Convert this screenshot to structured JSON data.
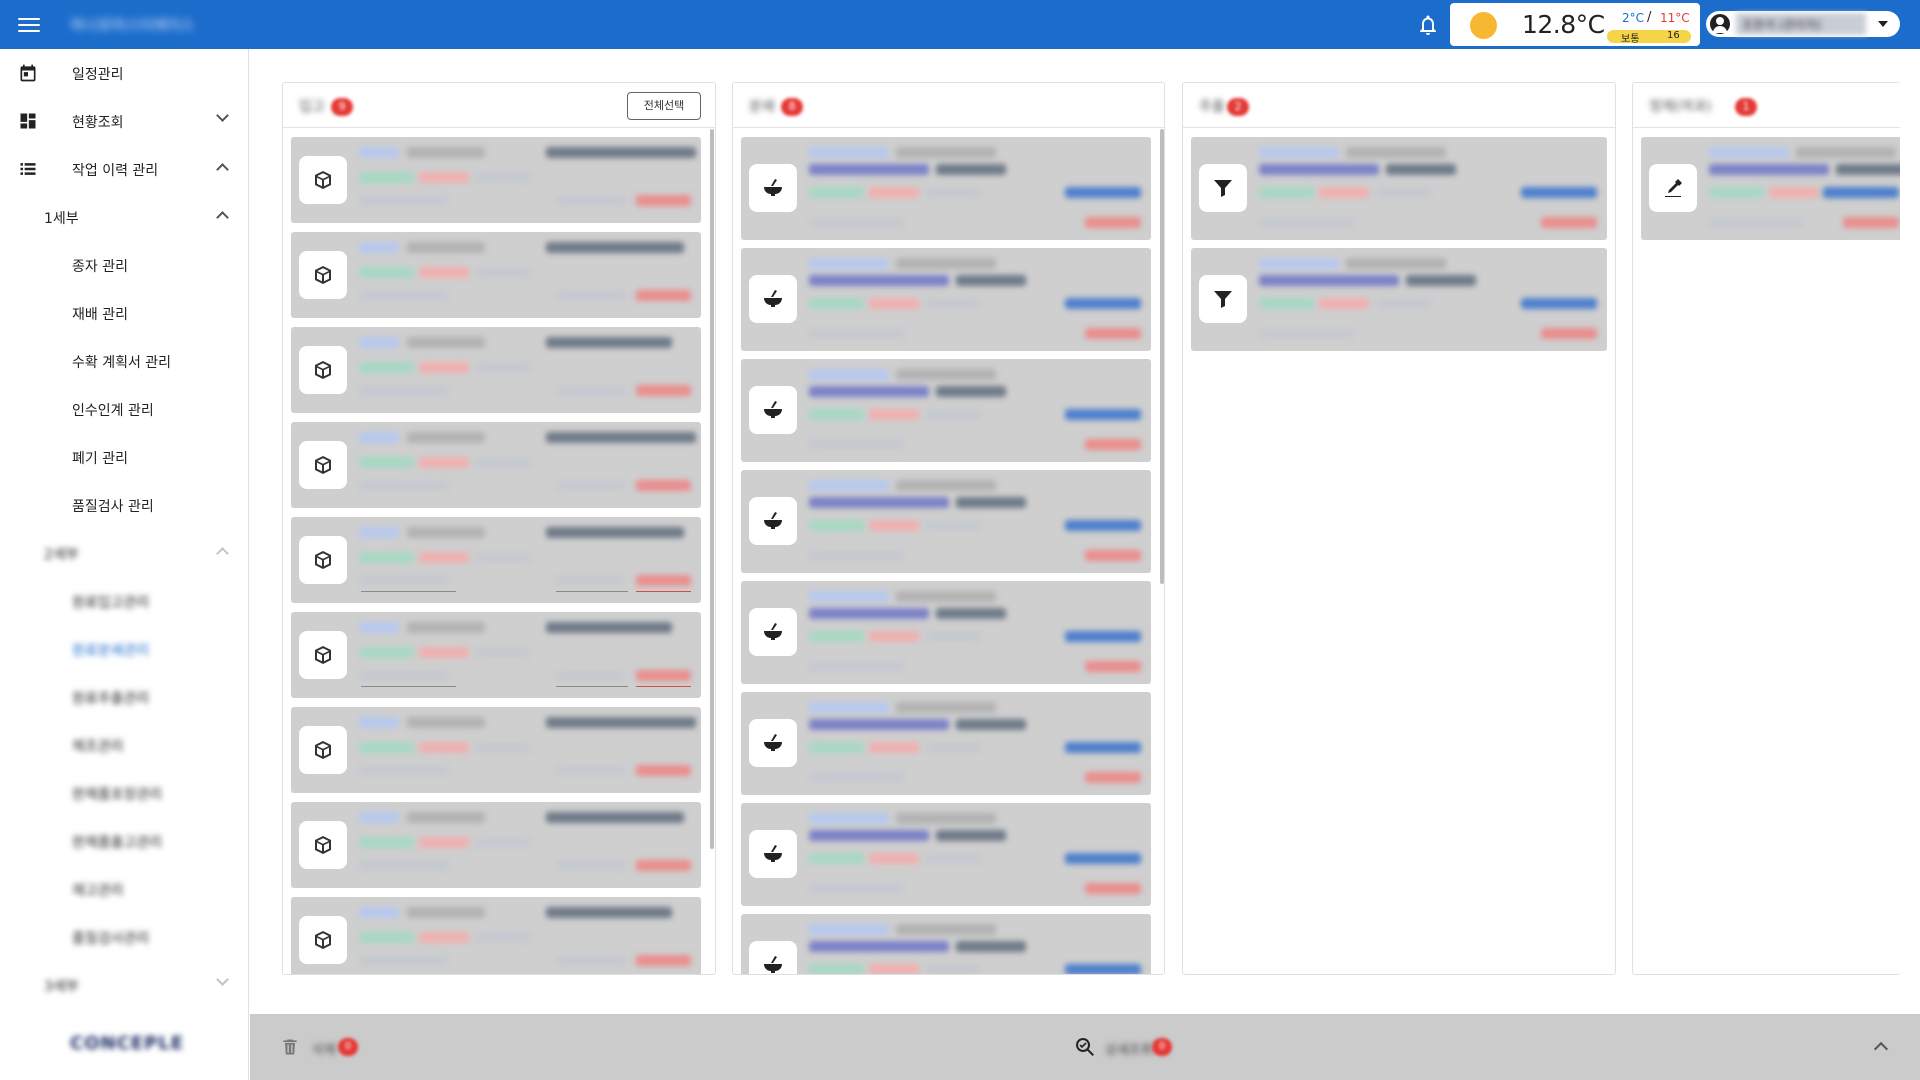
{
  "header": {
    "app_title": "하나로마스터에이스",
    "weather": {
      "temperature": "12.8°C",
      "min": "2°C",
      "slash": "/",
      "max": "11°C",
      "air_quality_label": "보통",
      "air_quality_value": "16"
    },
    "user_name": "조현석 (관리자)",
    "icons": [
      "menu-icon",
      "bell-icon",
      "sun-icon",
      "account-circle-icon",
      "caret-down-icon"
    ]
  },
  "sidebar": {
    "items": [
      {
        "label": "일정관리",
        "icon": "calendar-icon"
      },
      {
        "label": "현황조회",
        "icon": "dashboard-icon"
      },
      {
        "label": "작업 이력 관리",
        "icon": "list-icon"
      }
    ],
    "group": "1세부",
    "sub_items": [
      "종자 관리",
      "재배 관리",
      "수확 계획서 관리",
      "인수인계 관리",
      "폐기 관리",
      "품질검사 관리"
    ],
    "group2": "2세부",
    "group2_items": [
      "원료입고관리",
      "원료분쇄관리",
      "원료추출관리",
      "제조관리",
      "완제품포장관리",
      "완제품출고관리",
      "재고관리",
      "품질검사관리"
    ],
    "group3": "3세부",
    "logo": "CONCEPLE"
  },
  "columns": [
    {
      "title": "입고",
      "count": "9",
      "select_all_label": "전체선택"
    },
    {
      "title": "분쇄",
      "count": "8"
    },
    {
      "title": "추출",
      "count": "2"
    },
    {
      "title": "정제(여과)",
      "count": "1"
    }
  ],
  "bottom_bar": {
    "delete_label": "삭제",
    "delete_count": "0",
    "detail_label": "상세조회",
    "detail_count": "0"
  }
}
